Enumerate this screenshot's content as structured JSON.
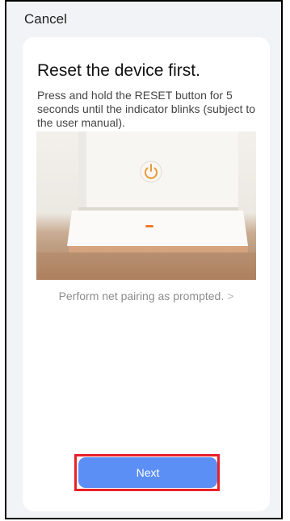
{
  "header": {
    "cancel_label": "Cancel"
  },
  "card": {
    "title": "Reset the device first.",
    "description": "Press and hold the RESET button for 5 seconds until the indicator blinks (subject to the user manual).",
    "pairing_link": "Perform net pairing as prompted.",
    "pairing_chevron": ">",
    "next_label": "Next"
  },
  "colors": {
    "accent": "#5b8ff5",
    "highlight_outline": "#e8202a",
    "power_icon": "#e89a3a",
    "indicator_led": "#f07b2e"
  },
  "icons": [
    "power-icon",
    "chevron-right-icon"
  ]
}
